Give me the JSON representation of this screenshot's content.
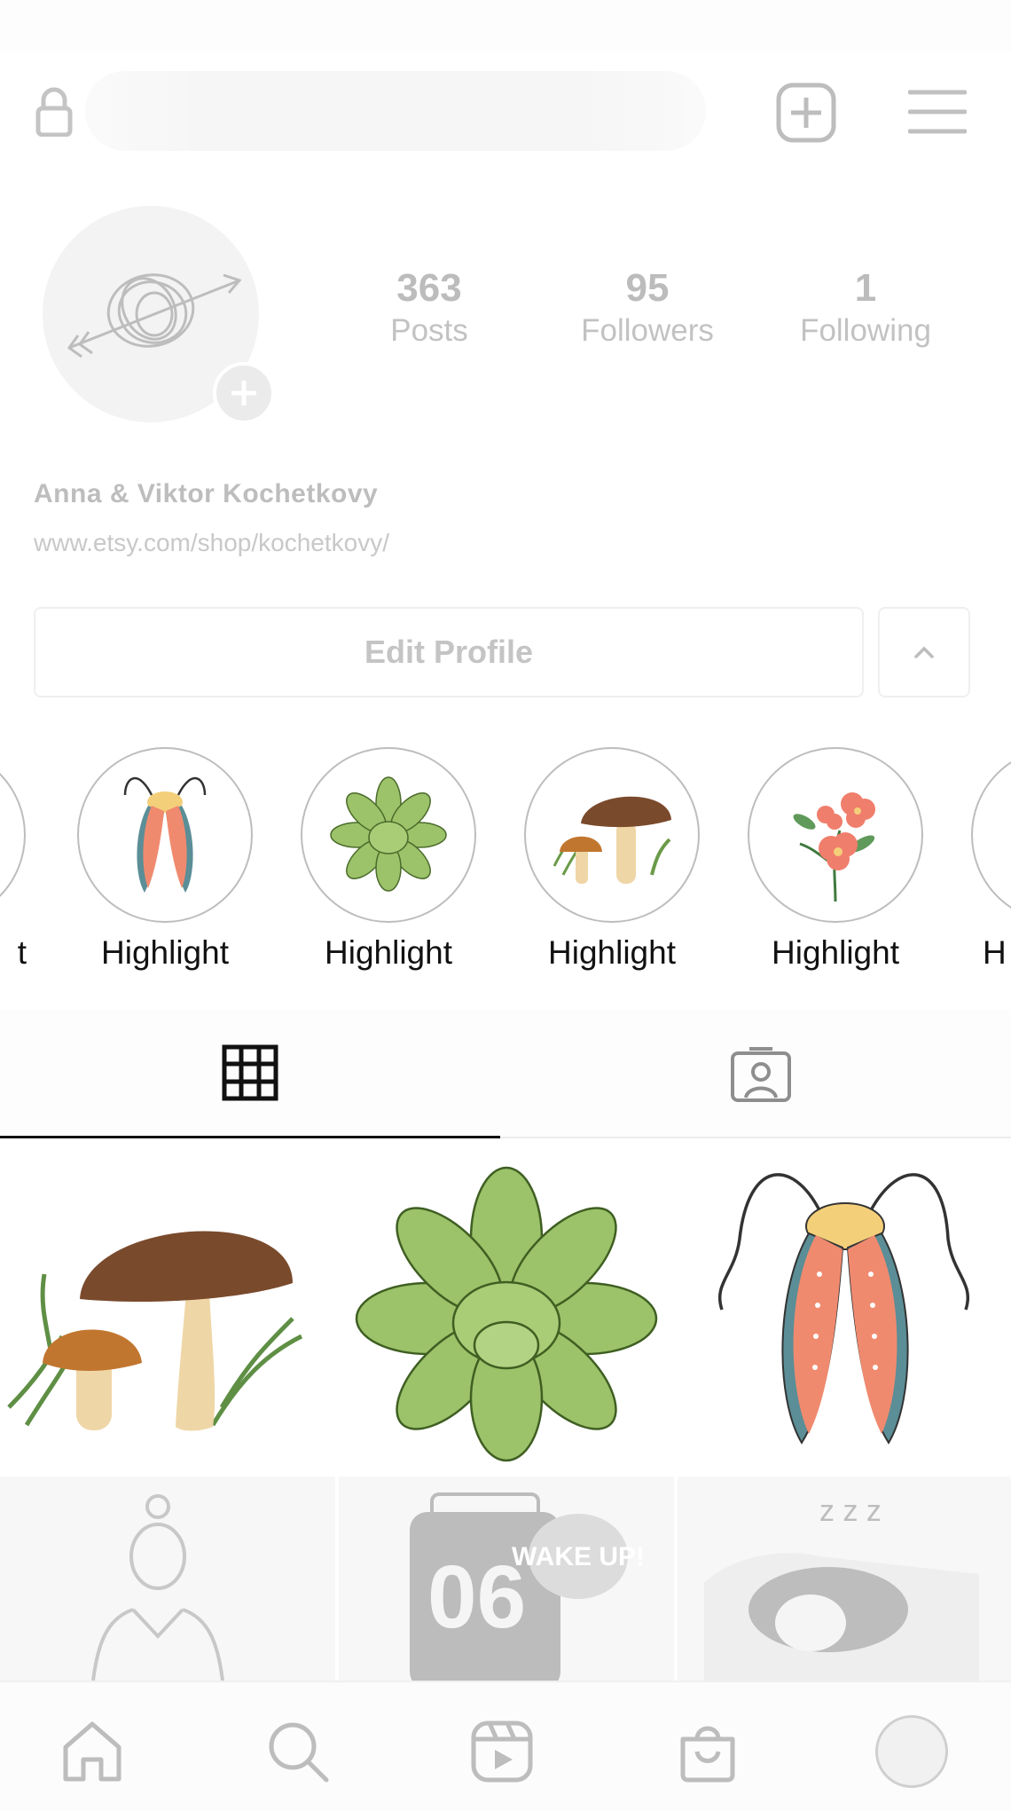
{
  "header": {
    "lock_icon": "lock-icon",
    "new_post_icon": "plus-square-icon",
    "menu_icon": "hamburger-menu-icon"
  },
  "profile": {
    "posts_count": "363",
    "posts_label": "Posts",
    "followers_count": "95",
    "followers_label": "Followers",
    "following_count": "1",
    "following_label": "Following",
    "display_name": "Anna & Viktor Kochetkovy",
    "website": "www.etsy.com/shop/kochetkovy/",
    "edit_profile_label": "Edit Profile"
  },
  "highlights": [
    {
      "label": "t",
      "icon": "partial-highlight-icon"
    },
    {
      "label": "Highlight",
      "icon": "moth-icon"
    },
    {
      "label": "Highlight",
      "icon": "succulent-icon"
    },
    {
      "label": "Highlight",
      "icon": "mushroom-icon"
    },
    {
      "label": "Highlight",
      "icon": "flower-icon"
    },
    {
      "label": "H",
      "icon": "partial-highlight-icon"
    }
  ],
  "tabs": [
    {
      "name": "grid",
      "icon": "grid-icon",
      "active": true
    },
    {
      "name": "tagged",
      "icon": "tagged-person-icon",
      "active": false
    }
  ],
  "posts": [
    {
      "icon": "mushroom-icon"
    },
    {
      "icon": "succulent-icon"
    },
    {
      "icon": "moth-icon"
    },
    {
      "icon": "girl-figure-icon"
    },
    {
      "icon": "alarm-clock-icon",
      "text1": "06",
      "text2": "WAKE UP!"
    },
    {
      "icon": "sleeping-person-icon",
      "text": "z z z"
    }
  ],
  "bottom_nav": [
    {
      "icon": "home-icon"
    },
    {
      "icon": "search-icon"
    },
    {
      "icon": "reels-icon"
    },
    {
      "icon": "shop-bag-icon"
    },
    {
      "icon": "profile-avatar-icon"
    }
  ],
  "colors": {
    "moth_wing": "#f08a6f",
    "moth_edge": "#5b8e96",
    "succulent": "#9cc26a",
    "mushroom_cap": "#7a4a2c",
    "flower": "#f07e6c"
  }
}
